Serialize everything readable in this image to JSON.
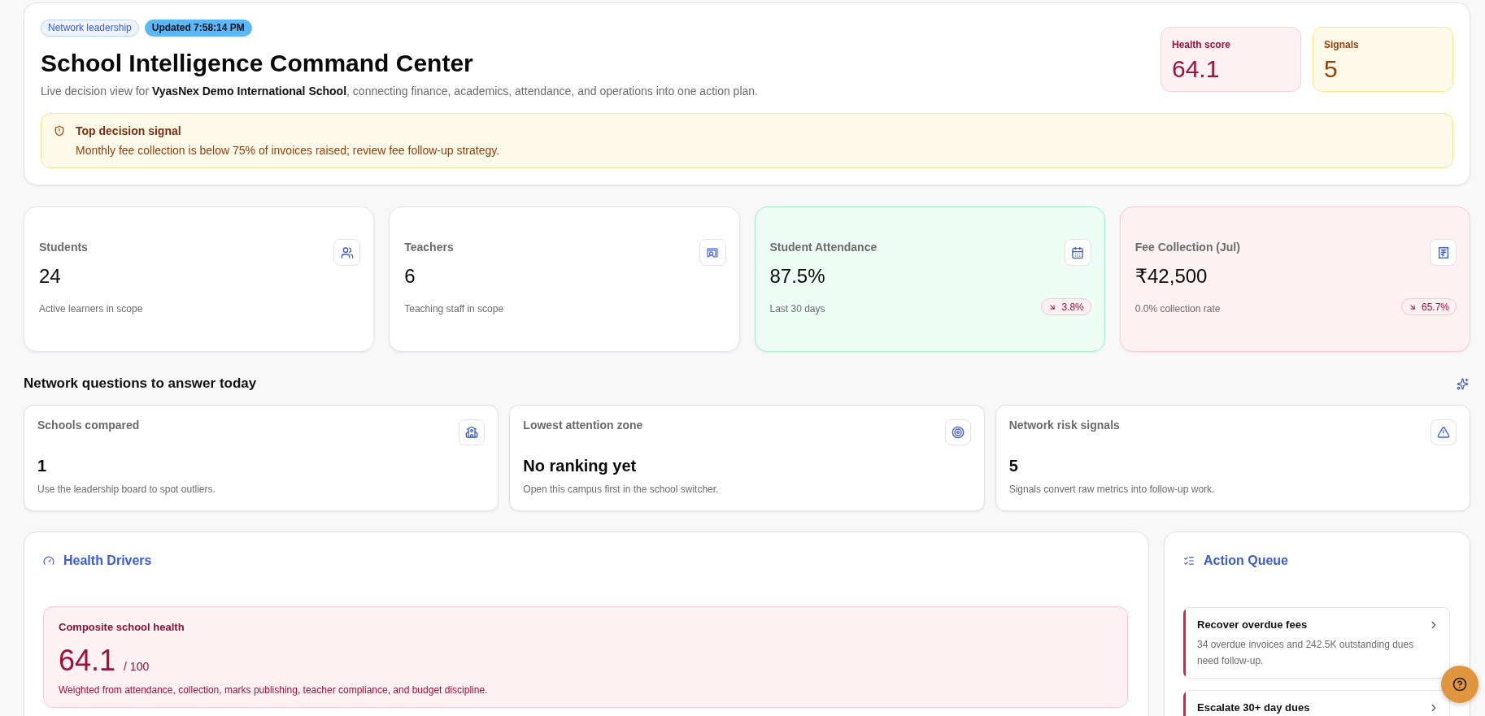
{
  "header": {
    "tags": [
      {
        "label": "Network leadership",
        "kind": "outline"
      },
      {
        "label": "Updated 7:58:14 PM",
        "kind": "filled"
      }
    ],
    "title": "School Intelligence Command Center",
    "subtitle": "Live decision view for **VyasNex Demo International School**, connecting finance, academics, attendance, and operations into one action plan.",
    "summary_tiles": [
      {
        "label": "Health score",
        "value": "64.1",
        "kind": "danger"
      },
      {
        "label": "Signals",
        "value": "5",
        "kind": "warning"
      }
    ],
    "alert": {
      "title": "Top decision signal",
      "message": "Monthly fee collection is below 75% of invoices raised; review fee follow-up strategy."
    }
  },
  "stat_cards": [
    {
      "label": "Students",
      "value": "24",
      "note": "Active learners in scope",
      "kind": "plain"
    },
    {
      "label": "Teachers",
      "value": "6",
      "note": "Teaching staff in scope",
      "kind": "plain"
    },
    {
      "label": "Student Attendance",
      "value": "87.5%",
      "note": "Last 30 days",
      "kind": "success",
      "trend": {
        "label": "3.8%"
      }
    },
    {
      "label": "Fee Collection (Jul)",
      "value": "₹42,500",
      "note": "0.0% collection rate",
      "kind": "danger",
      "trend": {
        "label": "65.7%"
      }
    }
  ],
  "network_questions": {
    "title": "Network questions to answer today",
    "cards": [
      {
        "label": "Schools compared",
        "value": "1",
        "note": "Use the leadership board to spot outliers."
      },
      {
        "label": "Lowest attention zone",
        "value": "No ranking yet",
        "note": "Open this campus first in the school switcher."
      },
      {
        "label": "Network risk signals",
        "value": "5",
        "note": "Signals convert raw metrics into follow-up work."
      }
    ]
  },
  "health_drivers": {
    "title": "Health Drivers",
    "composite": {
      "label": "Composite school health",
      "value": "64.1",
      "scale": "/ 100",
      "note": "Weighted from attendance, collection, marks publishing, teacher compliance, and budget discipline."
    }
  },
  "action_queue": {
    "title": "Action Queue",
    "items": [
      {
        "title": "Recover overdue fees",
        "description": "34 overdue invoices and 242.5K outstanding dues need follow-up.",
        "color": "#e11d48"
      },
      {
        "title": "Escalate 30+ day dues",
        "color": "#e11d48"
      }
    ]
  }
}
